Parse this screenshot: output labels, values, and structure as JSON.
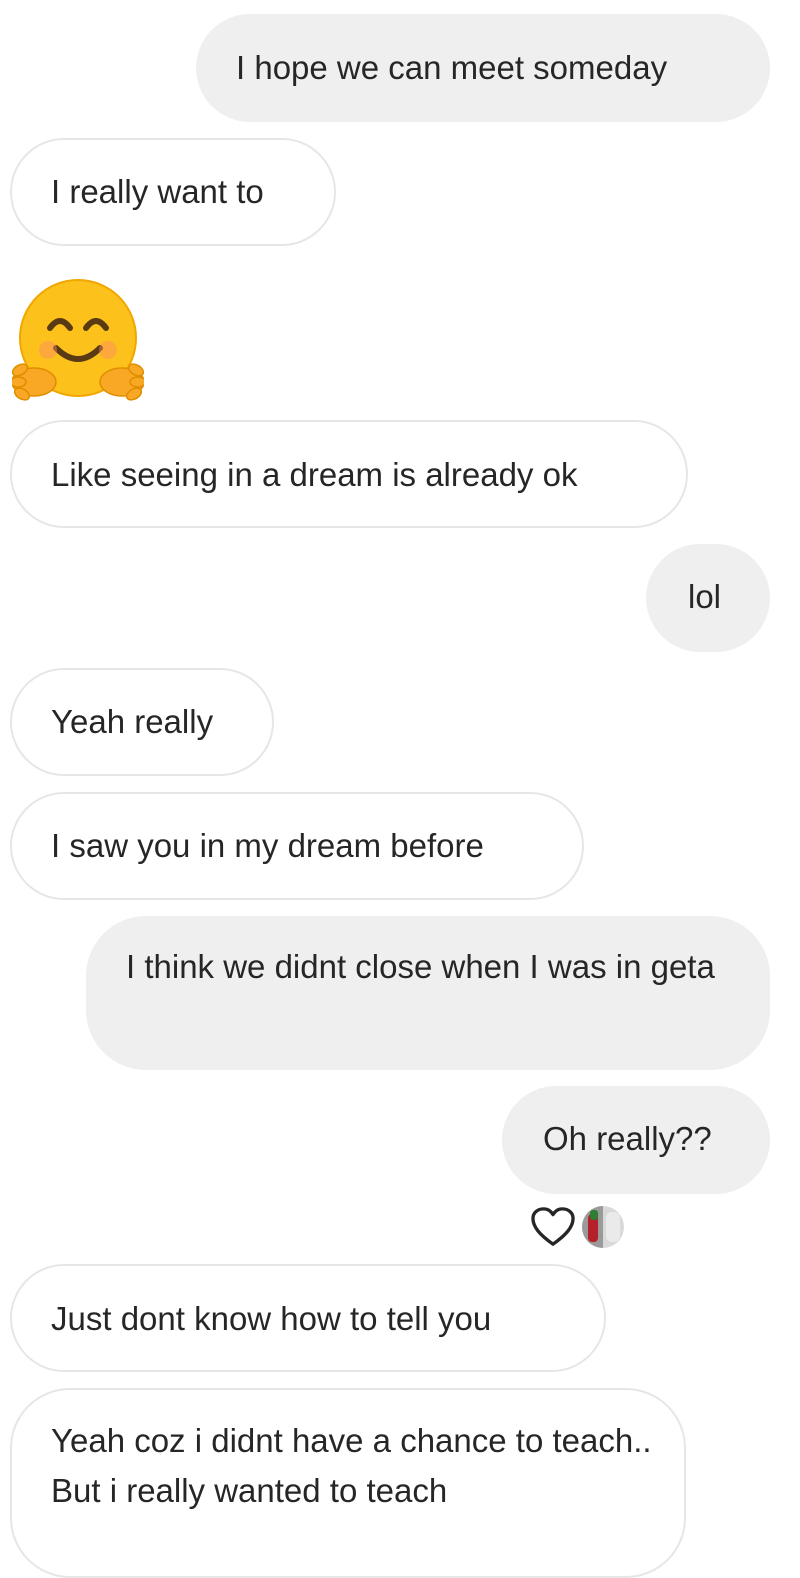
{
  "messages": [
    {
      "text": "I hope we can meet someday",
      "side": "outgoing"
    },
    {
      "text": "I really want to",
      "side": "incoming"
    },
    {
      "emoji": "hugging-face-emoji",
      "side": "incoming"
    },
    {
      "text": "Like seeing in a dream is already ok",
      "side": "incoming"
    },
    {
      "text": "lol",
      "side": "outgoing"
    },
    {
      "text": "Yeah really",
      "side": "incoming"
    },
    {
      "text": "I saw you in my dream before",
      "side": "incoming"
    },
    {
      "text": "I think we didnt close when I was in geta",
      "side": "outgoing"
    },
    {
      "text": "Oh really??",
      "side": "outgoing",
      "reactions": [
        "heart-icon",
        "reactor-avatar"
      ]
    },
    {
      "text": "Just dont know how to tell you",
      "side": "incoming"
    },
    {
      "text": "Yeah coz i didnt have a chance to teach.. But i really wanted to teach",
      "side": "incoming"
    }
  ],
  "colors": {
    "outgoing_bubble": "#efefef",
    "incoming_border": "#e6e6e6",
    "text": "#262626",
    "emoji_face": "#fcc21b"
  }
}
